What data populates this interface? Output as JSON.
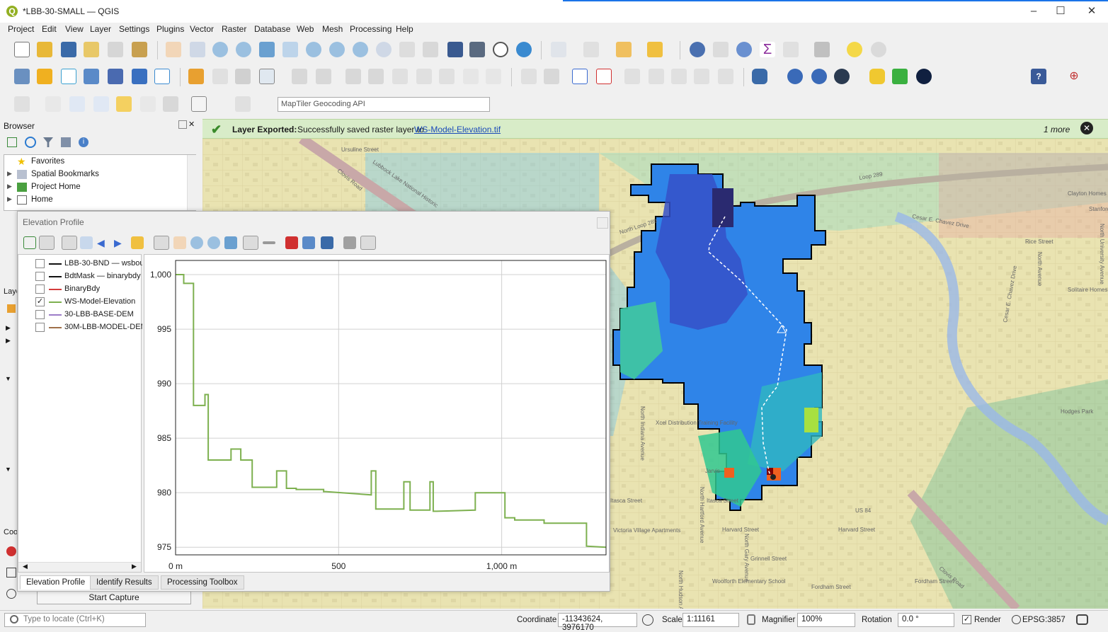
{
  "window": {
    "title": "*LBB-30-SMALL — QGIS"
  },
  "menu": [
    "Project",
    "Edit",
    "View",
    "Layer",
    "Settings",
    "Plugins",
    "Vector",
    "Raster",
    "Database",
    "Web",
    "Mesh",
    "Processing",
    "Help"
  ],
  "geocoder": {
    "placeholder": "MapTiler Geocoding API"
  },
  "message": {
    "title": "Layer Exported:",
    "text": "Successfully saved raster layer to",
    "link": "WS-Model-Elevation.tif",
    "more": "1 more"
  },
  "browser": {
    "title": "Browser",
    "items": [
      {
        "label": "Favorites",
        "icon": "star-icon"
      },
      {
        "label": "Spatial Bookmarks",
        "icon": "bookmark-icon"
      },
      {
        "label": "Project Home",
        "icon": "project-home-icon"
      },
      {
        "label": "Home",
        "icon": "home-icon"
      }
    ]
  },
  "side_stubs": {
    "layers": "Laye",
    "coordinates": "Coo"
  },
  "elevation_profile": {
    "title": "Elevation Profile",
    "layers": [
      {
        "name": "LBB-30-BND — wsboun",
        "checked": false,
        "color": "#111111"
      },
      {
        "name": "BdtMask — binarybdy",
        "checked": false,
        "color": "#111111"
      },
      {
        "name": "BinaryBdy",
        "checked": false,
        "color": "#d43c3c"
      },
      {
        "name": "WS-Model-Elevation",
        "checked": true,
        "color": "#7db04f"
      },
      {
        "name": "30-LBB-BASE-DEM",
        "checked": false,
        "color": "#9c7cc8"
      },
      {
        "name": "30M-LBB-MODEL-DEM",
        "checked": false,
        "color": "#a0704a"
      }
    ],
    "tabs": [
      "Elevation Profile",
      "Identify Results",
      "Processing Toolbox"
    ],
    "check_mark": "✓"
  },
  "capture_button": "Start Capture",
  "chart_data": {
    "type": "line",
    "series": [
      {
        "color": "#7db04f",
        "x": [
          0,
          25,
          25,
          55,
          55,
          90,
          90,
          100,
          100,
          110,
          110,
          115,
          115,
          120,
          120,
          170,
          170,
          200,
          200,
          205,
          205,
          235,
          235,
          310,
          310,
          340,
          340,
          370,
          370,
          382,
          382,
          400,
          400,
          430,
          430,
          454,
          454,
          460,
          460,
          600,
          600,
          614,
          614,
          622,
          622,
          700,
          700,
          719,
          719,
          728,
          728,
          780,
          780,
          790,
          790,
          800,
          800,
          919,
          919,
          1010,
          1010,
          1040,
          1040,
          1130,
          1130,
          1260,
          1260,
          1320
        ],
        "y": [
          1000,
          1000,
          999.2,
          999.2,
          988,
          988,
          989,
          989,
          983,
          983,
          983,
          983,
          983,
          983,
          983,
          983,
          984,
          984,
          983,
          983,
          983,
          983,
          980.5,
          980.5,
          982,
          982,
          980.4,
          980.4,
          980.3,
          980.3,
          980.3,
          980.3,
          980.3,
          980.3,
          980.3,
          980.3,
          980.1,
          980.1,
          980.1,
          979.8,
          982,
          982,
          978.5,
          978.5,
          978.5,
          978.5,
          981,
          981,
          978.4,
          978.4,
          978.4,
          978.4,
          981,
          981,
          978.3,
          978.3,
          978.3,
          978.4,
          980,
          980,
          977.7,
          977.7,
          977.5,
          977.5,
          977.2,
          977.2,
          975.1,
          975.0
        ]
      }
    ],
    "xlim": [
      0,
      1320
    ],
    "ylim": [
      974.3,
      1001.3
    ],
    "xticks": [
      {
        "v": 0,
        "label": "0 m"
      },
      {
        "v": 500,
        "label": "500"
      },
      {
        "v": 1000,
        "label": "1,000 m"
      }
    ],
    "yticks": [
      {
        "v": 1000,
        "label": "1,000"
      },
      {
        "v": 995,
        "label": "995"
      },
      {
        "v": 990,
        "label": "990"
      },
      {
        "v": 985,
        "label": "985"
      },
      {
        "v": 980,
        "label": "980"
      },
      {
        "v": 975,
        "label": "975"
      }
    ],
    "grid": true
  },
  "map_labels": [
    "North Loop 289",
    "Loop 289",
    "Ursuline Street",
    "Clovis Road",
    "Lubbock Lake National Historic",
    "Cesar E. Chavez Drive",
    "Clayton Homes",
    "Stanford",
    "Rice Street",
    "North Avenue",
    "North University Avenue",
    "Solitaire Homes",
    "Cesar E. Chavez Drive",
    "Hodges Park",
    "North Indiana Avenue",
    "Xcel Distribution Training Facility",
    "Itasca Street",
    "Itasca Street",
    "Harvard Street",
    "Harvard Street",
    "Grinnell Street",
    "North Hartford Avenue",
    "North Gary Avenue",
    "Woolforth Elementary School",
    "Fordham Street",
    "Fordham Street",
    "Clovis Road",
    "US 84",
    "Jarvis",
    "Victoria Village Apartments",
    "North Hudson Avenue"
  ],
  "status": {
    "locate_placeholder": "Type to locate (Ctrl+K)",
    "coordinate_label": "Coordinate",
    "coordinate": "-11343624, 3976170",
    "scale_label": "Scale",
    "scale": "1:11161",
    "magnifier_label": "Magnifier",
    "magnifier": "100%",
    "rotation_label": "Rotation",
    "rotation": "0.0 °",
    "render_label": "Render",
    "crs": "EPSG:3857"
  }
}
